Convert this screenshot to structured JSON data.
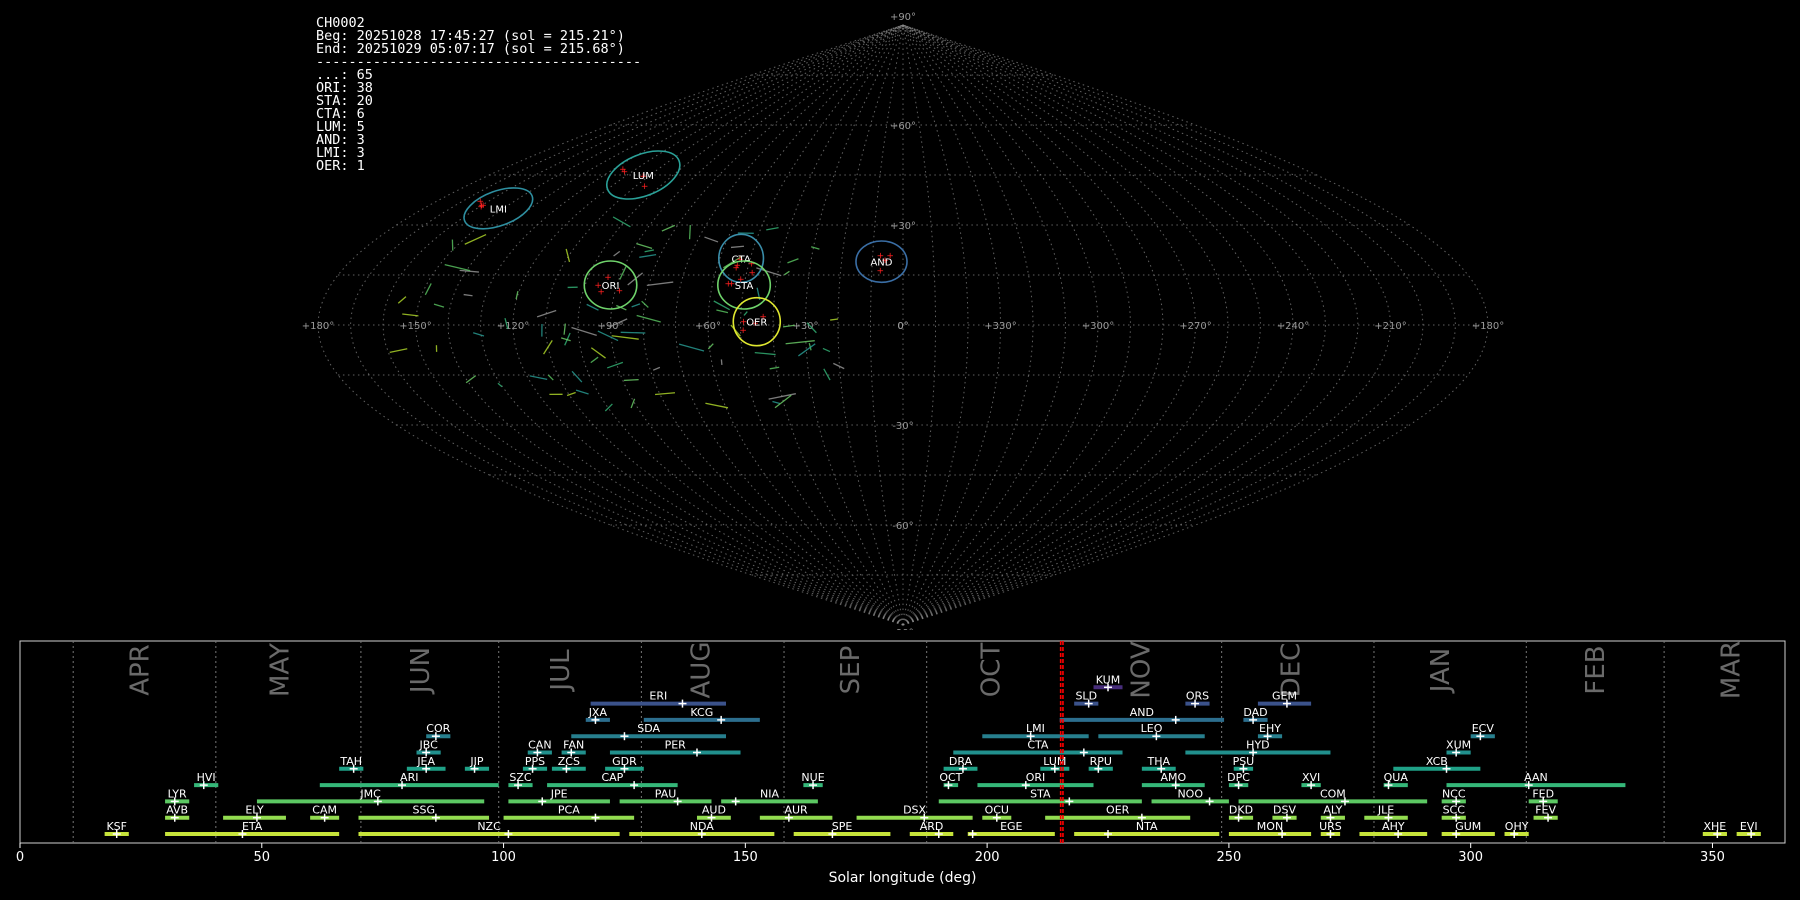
{
  "info": {
    "lines": [
      "CH0002",
      "Beg: 20251028 17:45:27 (sol = 215.21°)",
      "End: 20251029 05:07:17 (sol = 215.68°)",
      "----------------------------------------",
      "...: 65",
      "ORI: 38",
      "STA: 20",
      "CTA: 6",
      "LUM: 5",
      "AND: 3",
      "LMI: 3",
      "OER: 1"
    ]
  },
  "colors": {
    "background": "#000000",
    "grid": "#8a8a8a",
    "sol_marker": "#ff0000",
    "radiant_point": "#ff2020",
    "ellipse_teal": "#2aa198",
    "ellipse_blue": "#3a6ea5",
    "ellipse_green": "#6fd36b",
    "ellipse_yellow": "#e0e830"
  },
  "chart_data": [
    {
      "type": "scatter",
      "projection": "sinusoidal-sky-map",
      "lat_labels": [
        "+90°",
        "+60°",
        "+30°",
        "0°",
        "-30°",
        "-60°",
        "-90°"
      ],
      "lon_labels": [
        "+180°",
        "+150°",
        "+120°",
        "+90°",
        "+60°",
        "+30°",
        "0°",
        "+330°",
        "+300°",
        "+270°",
        "+240°",
        "+210°",
        "+180°"
      ],
      "grid": true,
      "radiants": [
        {
          "code": "LUM",
          "lon": 113,
          "lat": 45,
          "a": 15,
          "b": 5,
          "tilt": -22,
          "color": "#2aa198"
        },
        {
          "code": "LMI",
          "lon": 152,
          "lat": 35,
          "a": 12,
          "b": 4,
          "tilt": -20,
          "color": "#2e8fa0"
        },
        {
          "code": "CTA",
          "lon": 53,
          "lat": 20,
          "a": 6,
          "b": 6,
          "tilt": 0,
          "color": "#3a8eaa"
        },
        {
          "code": "AND",
          "lon": 7,
          "lat": 19,
          "a": 7,
          "b": 5,
          "tilt": 0,
          "color": "#3a6ea5"
        },
        {
          "code": "ORI",
          "lon": 92,
          "lat": 12,
          "a": 7,
          "b": 6,
          "tilt": 0,
          "color": "#6fd36b"
        },
        {
          "code": "STA",
          "lon": 50,
          "lat": 12,
          "a": 7,
          "b": 6,
          "tilt": 0,
          "color": "#6fd36b"
        },
        {
          "code": "OER",
          "lon": 45,
          "lat": 1,
          "a": 6,
          "b": 6,
          "tilt": 0,
          "color": "#e0e830"
        }
      ]
    },
    {
      "type": "bar",
      "subtype": "timeline",
      "xlabel": "Solar longitude (deg)",
      "xlim": [
        0,
        365
      ],
      "xticks": [
        0,
        50,
        100,
        150,
        200,
        250,
        300,
        350
      ],
      "current_sol": [
        215.21,
        215.68
      ],
      "month_boundaries": [
        11,
        40.5,
        70.5,
        99,
        128.5,
        158,
        187.5,
        248.5,
        280,
        311.5,
        340
      ],
      "months": [
        {
          "label": "APR",
          "sol": 25
        },
        {
          "label": "MAY",
          "sol": 54
        },
        {
          "label": "JUN",
          "sol": 83
        },
        {
          "label": "JUL",
          "sol": 112
        },
        {
          "label": "AUG",
          "sol": 141
        },
        {
          "label": "SEP",
          "sol": 172
        },
        {
          "label": "OCT",
          "sol": 201
        },
        {
          "label": "NOV",
          "sol": 232
        },
        {
          "label": "DEC",
          "sol": 263
        },
        {
          "label": "JAN",
          "sol": 294
        },
        {
          "label": "FEB",
          "sol": 326
        },
        {
          "label": "MAR",
          "sol": 354
        }
      ],
      "showers": [
        {
          "code": "KSF",
          "start": 17.5,
          "end": 22.5,
          "peak": 20,
          "row": 0,
          "color": "#c6e33a"
        },
        {
          "code": "ETA",
          "start": 30,
          "end": 66,
          "peak": 46,
          "row": 0,
          "color": "#c6e33a"
        },
        {
          "code": "NZC",
          "start": 70,
          "end": 124,
          "peak": 101,
          "row": 0,
          "color": "#c6e33a"
        },
        {
          "code": "NDA",
          "start": 126,
          "end": 156,
          "peak": 141,
          "row": 0,
          "color": "#c6e33a"
        },
        {
          "code": "SPE",
          "start": 160,
          "end": 180,
          "peak": 168,
          "row": 0,
          "color": "#c6e33a"
        },
        {
          "code": "ARD",
          "start": 184,
          "end": 193,
          "peak": 190,
          "row": 0,
          "color": "#c6e33a"
        },
        {
          "code": "EGE",
          "start": 196,
          "end": 214,
          "peak": 197,
          "row": 0,
          "color": "#c6e33a"
        },
        {
          "code": "NTA",
          "start": 218,
          "end": 248,
          "peak": 225,
          "row": 0,
          "color": "#c6e33a"
        },
        {
          "code": "MON",
          "start": 250,
          "end": 267,
          "peak": 261,
          "row": 0,
          "color": "#c6e33a"
        },
        {
          "code": "URS",
          "start": 269,
          "end": 273,
          "peak": 271,
          "row": 0,
          "color": "#c6e33a"
        },
        {
          "code": "AHY",
          "start": 277,
          "end": 291,
          "peak": 285,
          "row": 0,
          "color": "#c6e33a"
        },
        {
          "code": "GUM",
          "start": 294,
          "end": 305,
          "peak": 297,
          "row": 0,
          "color": "#c6e33a"
        },
        {
          "code": "OHY",
          "start": 307,
          "end": 312,
          "peak": 309,
          "row": 0,
          "color": "#c6e33a"
        },
        {
          "code": "XHE",
          "start": 348,
          "end": 353,
          "peak": 351,
          "row": 0,
          "color": "#c6e33a"
        },
        {
          "code": "EVI",
          "start": 355,
          "end": 360,
          "peak": 358,
          "row": 0,
          "color": "#c6e33a"
        },
        {
          "code": "AVB",
          "start": 30,
          "end": 35,
          "peak": 32,
          "row": 1,
          "color": "#93dc50"
        },
        {
          "code": "ELY",
          "start": 42,
          "end": 55,
          "peak": 49,
          "row": 1,
          "color": "#93dc50"
        },
        {
          "code": "CAM",
          "start": 60,
          "end": 66,
          "peak": 63,
          "row": 1,
          "color": "#93dc50"
        },
        {
          "code": "SSG",
          "start": 70,
          "end": 97,
          "peak": 86,
          "row": 1,
          "color": "#93dc50"
        },
        {
          "code": "PCA",
          "start": 100,
          "end": 127,
          "peak": 119,
          "row": 1,
          "color": "#93dc50"
        },
        {
          "code": "AUD",
          "start": 140,
          "end": 147,
          "peak": 143,
          "row": 1,
          "color": "#93dc50"
        },
        {
          "code": "AUR",
          "start": 153,
          "end": 168,
          "peak": 159,
          "row": 1,
          "color": "#93dc50"
        },
        {
          "code": "DSX",
          "start": 173,
          "end": 197,
          "peak": 187,
          "row": 1,
          "color": "#93dc50"
        },
        {
          "code": "OCU",
          "start": 199,
          "end": 205,
          "peak": 202,
          "row": 1,
          "color": "#93dc50"
        },
        {
          "code": "OER",
          "start": 212,
          "end": 242,
          "peak": 232,
          "row": 1,
          "color": "#93dc50"
        },
        {
          "code": "DKD",
          "start": 250,
          "end": 255,
          "peak": 252,
          "row": 1,
          "color": "#93dc50"
        },
        {
          "code": "DSV",
          "start": 259,
          "end": 264,
          "peak": 262,
          "row": 1,
          "color": "#93dc50"
        },
        {
          "code": "ALY",
          "start": 269,
          "end": 274,
          "peak": 271,
          "row": 1,
          "color": "#93dc50"
        },
        {
          "code": "JLE",
          "start": 278,
          "end": 287,
          "peak": 283,
          "row": 1,
          "color": "#93dc50"
        },
        {
          "code": "SCC",
          "start": 294,
          "end": 299,
          "peak": 297,
          "row": 1,
          "color": "#93dc50"
        },
        {
          "code": "FEV",
          "start": 313,
          "end": 318,
          "peak": 316,
          "row": 1,
          "color": "#93dc50"
        },
        {
          "code": "LYR",
          "start": 30,
          "end": 35,
          "peak": 32,
          "row": 2,
          "color": "#5cc863"
        },
        {
          "code": "JMC",
          "start": 49,
          "end": 96,
          "peak": 74,
          "row": 2,
          "color": "#5cc863"
        },
        {
          "code": "JPE",
          "start": 101,
          "end": 122,
          "peak": 108,
          "row": 2,
          "color": "#5cc863"
        },
        {
          "code": "PAU",
          "start": 124,
          "end": 143,
          "peak": 136,
          "row": 2,
          "color": "#5cc863"
        },
        {
          "code": "NIA",
          "start": 145,
          "end": 165,
          "peak": 148,
          "row": 2,
          "color": "#5cc863"
        },
        {
          "code": "STA",
          "start": 190,
          "end": 232,
          "peak": 217,
          "row": 2,
          "color": "#5cc863"
        },
        {
          "code": "NOO",
          "start": 234,
          "end": 250,
          "peak": 246,
          "row": 2,
          "color": "#5cc863"
        },
        {
          "code": "COM",
          "start": 252,
          "end": 291,
          "peak": 274,
          "row": 2,
          "color": "#5cc863"
        },
        {
          "code": "NCC",
          "start": 294,
          "end": 299,
          "peak": 297,
          "row": 2,
          "color": "#5cc863"
        },
        {
          "code": "FED",
          "start": 312,
          "end": 318,
          "peak": 315,
          "row": 2,
          "color": "#5cc863"
        },
        {
          "code": "HVI",
          "start": 36,
          "end": 41,
          "peak": 38,
          "row": 3,
          "color": "#35b779"
        },
        {
          "code": "ARI",
          "start": 62,
          "end": 99,
          "peak": 79,
          "row": 3,
          "color": "#35b779"
        },
        {
          "code": "SZC",
          "start": 101,
          "end": 106,
          "peak": 103,
          "row": 3,
          "color": "#35b779"
        },
        {
          "code": "CAP",
          "start": 109,
          "end": 136,
          "peak": 127,
          "row": 3,
          "color": "#35b779"
        },
        {
          "code": "NUE",
          "start": 162,
          "end": 166,
          "peak": 164,
          "row": 3,
          "color": "#35b779"
        },
        {
          "code": "OCT",
          "start": 191,
          "end": 194,
          "peak": 192,
          "row": 3,
          "color": "#35b779"
        },
        {
          "code": "ORI",
          "start": 198,
          "end": 222,
          "peak": 208,
          "row": 3,
          "color": "#35b779"
        },
        {
          "code": "AMO",
          "start": 232,
          "end": 245,
          "peak": 239,
          "row": 3,
          "color": "#35b779"
        },
        {
          "code": "DPC",
          "start": 250,
          "end": 254,
          "peak": 252,
          "row": 3,
          "color": "#35b779"
        },
        {
          "code": "XVI",
          "start": 265,
          "end": 269,
          "peak": 267,
          "row": 3,
          "color": "#35b779"
        },
        {
          "code": "QUA",
          "start": 282,
          "end": 287,
          "peak": 283,
          "row": 3,
          "color": "#35b779"
        },
        {
          "code": "AAN",
          "start": 295,
          "end": 332,
          "peak": 312,
          "row": 3,
          "color": "#35b779"
        },
        {
          "code": "TAH",
          "start": 66,
          "end": 71,
          "peak": 69,
          "row": 4,
          "color": "#1fa187"
        },
        {
          "code": "JEA",
          "start": 80,
          "end": 88,
          "peak": 84,
          "row": 4,
          "color": "#1fa187"
        },
        {
          "code": "JIP",
          "start": 92,
          "end": 97,
          "peak": 94,
          "row": 4,
          "color": "#1fa187"
        },
        {
          "code": "PPS",
          "start": 104,
          "end": 109,
          "peak": 106,
          "row": 4,
          "color": "#1fa187"
        },
        {
          "code": "ZCS",
          "start": 110,
          "end": 117,
          "peak": 113,
          "row": 4,
          "color": "#1fa187"
        },
        {
          "code": "GDR",
          "start": 121,
          "end": 129,
          "peak": 125,
          "row": 4,
          "color": "#1fa187"
        },
        {
          "code": "DRA",
          "start": 191,
          "end": 198,
          "peak": 195,
          "row": 4,
          "color": "#1fa187"
        },
        {
          "code": "LUM",
          "start": 211,
          "end": 217,
          "peak": 214,
          "row": 4,
          "color": "#1fa187"
        },
        {
          "code": "RPU",
          "start": 221,
          "end": 226,
          "peak": 223,
          "row": 4,
          "color": "#1fa187"
        },
        {
          "code": "THA",
          "start": 232,
          "end": 239,
          "peak": 236,
          "row": 4,
          "color": "#1fa187"
        },
        {
          "code": "PSU",
          "start": 251,
          "end": 255,
          "peak": 253,
          "row": 4,
          "color": "#1fa187"
        },
        {
          "code": "XCB",
          "start": 284,
          "end": 302,
          "peak": 295,
          "row": 4,
          "color": "#1fa187"
        },
        {
          "code": "JBC",
          "start": 82,
          "end": 87,
          "peak": 84,
          "row": 5,
          "color": "#21908d"
        },
        {
          "code": "CAN",
          "start": 105,
          "end": 110,
          "peak": 107,
          "row": 5,
          "color": "#21908d"
        },
        {
          "code": "FAN",
          "start": 112,
          "end": 117,
          "peak": 114,
          "row": 5,
          "color": "#21908d"
        },
        {
          "code": "PER",
          "start": 122,
          "end": 149,
          "peak": 140,
          "row": 5,
          "color": "#21908d"
        },
        {
          "code": "CTA",
          "start": 193,
          "end": 228,
          "peak": 220,
          "row": 5,
          "color": "#21908d"
        },
        {
          "code": "HYD",
          "start": 241,
          "end": 271,
          "peak": 255,
          "row": 5,
          "color": "#21908d"
        },
        {
          "code": "XUM",
          "start": 295,
          "end": 300,
          "peak": 297,
          "row": 5,
          "color": "#21908d"
        },
        {
          "code": "COR",
          "start": 84,
          "end": 89,
          "peak": 86,
          "row": 6,
          "color": "#277f8e"
        },
        {
          "code": "SDA",
          "start": 114,
          "end": 146,
          "peak": 125,
          "row": 6,
          "color": "#277f8e"
        },
        {
          "code": "LMI",
          "start": 199,
          "end": 221,
          "peak": 209,
          "row": 6,
          "color": "#277f8e"
        },
        {
          "code": "LEO",
          "start": 223,
          "end": 245,
          "peak": 235,
          "row": 6,
          "color": "#277f8e"
        },
        {
          "code": "EHY",
          "start": 256,
          "end": 261,
          "peak": 258,
          "row": 6,
          "color": "#277f8e"
        },
        {
          "code": "ECV",
          "start": 300,
          "end": 305,
          "peak": 302,
          "row": 6,
          "color": "#277f8e"
        },
        {
          "code": "JXA",
          "start": 117,
          "end": 122,
          "peak": 119,
          "row": 7,
          "color": "#2c6e8e"
        },
        {
          "code": "KCG",
          "start": 129,
          "end": 153,
          "peak": 145,
          "row": 7,
          "color": "#2c6e8e"
        },
        {
          "code": "AND",
          "start": 215,
          "end": 249,
          "peak": 239,
          "row": 7,
          "color": "#2c6e8e"
        },
        {
          "code": "DAD",
          "start": 253,
          "end": 258,
          "peak": 255,
          "row": 7,
          "color": "#2c6e8e"
        },
        {
          "code": "ERI",
          "start": 118,
          "end": 146,
          "peak": 137,
          "row": 8,
          "color": "#3b528b"
        },
        {
          "code": "SLD",
          "start": 218,
          "end": 223,
          "peak": 221,
          "row": 8,
          "color": "#3b528b"
        },
        {
          "code": "ORS",
          "start": 241,
          "end": 246,
          "peak": 243,
          "row": 8,
          "color": "#3b528b"
        },
        {
          "code": "GEM",
          "start": 256,
          "end": 267,
          "peak": 262,
          "row": 8,
          "color": "#3b528b"
        },
        {
          "code": "KUM",
          "start": 222,
          "end": 228,
          "peak": 225,
          "row": 9,
          "color": "#472d7b"
        }
      ]
    }
  ]
}
